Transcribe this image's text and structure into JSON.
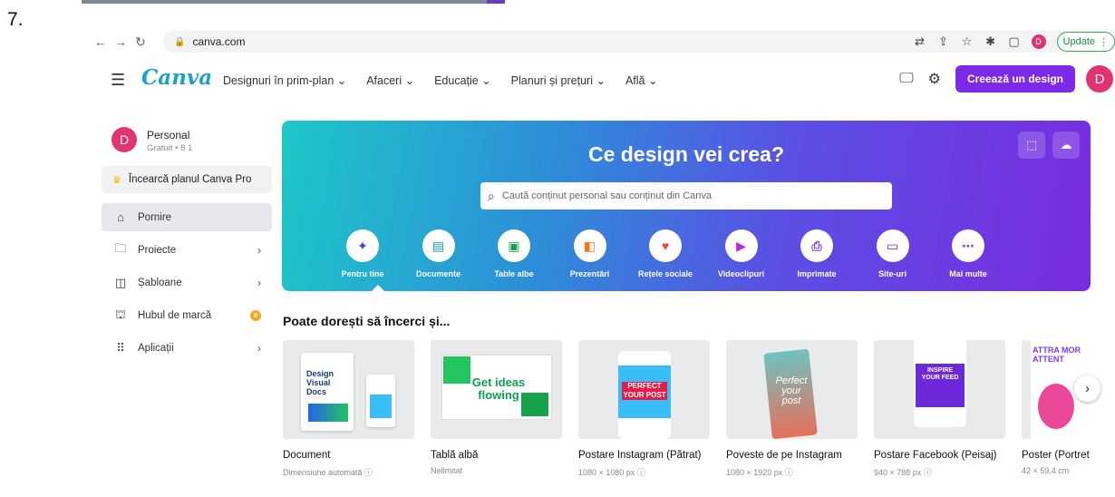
{
  "step_label": "7.",
  "browser": {
    "url": "canva.com",
    "update_label": "Update",
    "profile_initial": "D"
  },
  "header": {
    "logo": "Canva",
    "menus": [
      "Designuri în prim-plan ⌄",
      "Afaceri ⌄",
      "Educație ⌄",
      "Planuri și prețuri ⌄",
      "Află ⌄"
    ],
    "create_label": "Creează un design",
    "avatar_initial": "D"
  },
  "sidebar": {
    "account_initial": "D",
    "account_name": "Personal",
    "account_sub": "Gratuit • 8 1",
    "try_pro": "Încearcă planul Canva Pro",
    "items": [
      {
        "label": "Pornire"
      },
      {
        "label": "Proiecte"
      },
      {
        "label": "Șabloane"
      },
      {
        "label": "Hubul de marcă"
      },
      {
        "label": "Aplicații"
      }
    ]
  },
  "hero": {
    "title": "Ce design vei crea?",
    "search_placeholder": "Caută conținut personal sau conținut din Canva",
    "categories": [
      {
        "label": "Pentru tine",
        "icon": "sparkle",
        "color": "#3e43c4"
      },
      {
        "label": "Documente",
        "icon": "document",
        "color": "#13a3b5"
      },
      {
        "label": "Table albe",
        "icon": "whiteboard",
        "color": "#16a34a"
      },
      {
        "label": "Prezentări",
        "icon": "presentation",
        "color": "#f97316"
      },
      {
        "label": "Rețele sociale",
        "icon": "heart",
        "color": "#ef4444"
      },
      {
        "label": "Videoclipuri",
        "icon": "video",
        "color": "#c026d3"
      },
      {
        "label": "Imprimate",
        "icon": "print",
        "color": "#7c3aed"
      },
      {
        "label": "Site-uri",
        "icon": "website",
        "color": "#6d28d9"
      },
      {
        "label": "Mai multe",
        "icon": "more",
        "color": "#7c3aed"
      }
    ]
  },
  "suggestions": {
    "title": "Poate dorești să încerci și...",
    "cards": [
      {
        "title": "Document",
        "sub": "Dimensiune automată ⓘ",
        "thumb_text": "Design Visual Docs"
      },
      {
        "title": "Tablă albă",
        "sub": "Nelimitat",
        "thumb_text": "Get ideas flowing"
      },
      {
        "title": "Postare Instagram (Pătrat)",
        "sub": "1080 × 1080 px ⓘ",
        "thumb_text": "PERFECT YOUR POST"
      },
      {
        "title": "Poveste de pe Instagram",
        "sub": "1080 × 1920 px ⓘ",
        "thumb_text": "Perfect your post"
      },
      {
        "title": "Postare Facebook (Peisaj)",
        "sub": "940 × 788 px ⓘ",
        "thumb_text": "INSPIRE YOUR FEED"
      },
      {
        "title": "Poster (Portret",
        "sub": "42 × 59,4 cm",
        "thumb_text": "ATTRA MOR ATTENT"
      }
    ]
  }
}
